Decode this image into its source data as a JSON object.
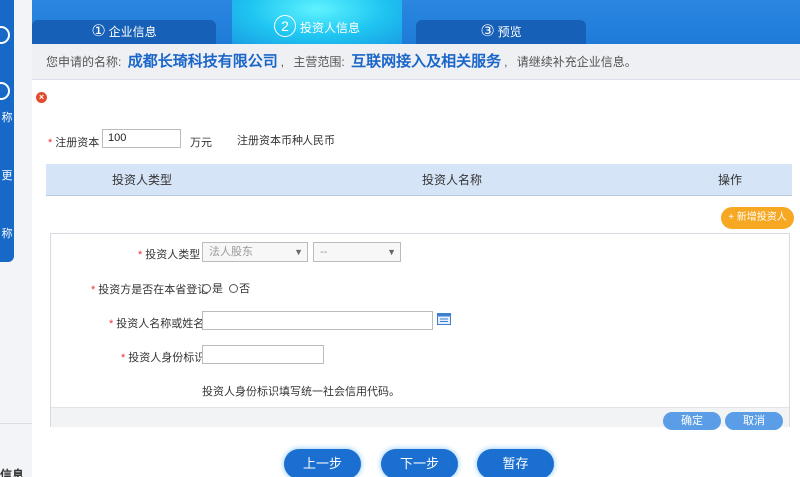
{
  "steps": [
    {
      "num": "①",
      "label": "企业信息"
    },
    {
      "num": "2",
      "label": "投资人信息"
    },
    {
      "num": "③",
      "label": "预览"
    }
  ],
  "info": {
    "prefix": "您申请的名称:",
    "company": "成都长琦科技有限公司",
    "sep1": ",",
    "scope_label": "主营范围:",
    "scope": "互联网接入及相关服务",
    "sep2": ",",
    "suffix": "请继续补充企业信息。"
  },
  "capital": {
    "label": "注册资本",
    "value": "100",
    "unit": "万元",
    "currency_label": "注册资本币种",
    "currency": "人民币"
  },
  "table": {
    "col_type": "投资人类型",
    "col_name": "投资人名称",
    "col_op": "操作"
  },
  "add_investor": "+ 新增投资人",
  "form": {
    "type_label": "投资人类型",
    "type_select": "法人股东",
    "type_select2": "--",
    "local_label": "投资方是否在本省登记",
    "radio_yes": "是",
    "radio_no": "否",
    "name_label": "投资人名称或姓名",
    "name_value": "",
    "id_label": "投资人身份标识",
    "id_value": "",
    "hint": "投资人身份标识填写统一社会信用代码。",
    "confirm": "确定",
    "cancel": "取消"
  },
  "nav": {
    "prev": "上一步",
    "next": "下一步",
    "save": "暂存"
  },
  "sidebar": {
    "chars": [
      "称",
      "更",
      "称"
    ],
    "bottom": "信息"
  },
  "colors": {
    "accent": "#1a66c9",
    "orange": "#f7a823",
    "required": "#e33333"
  }
}
